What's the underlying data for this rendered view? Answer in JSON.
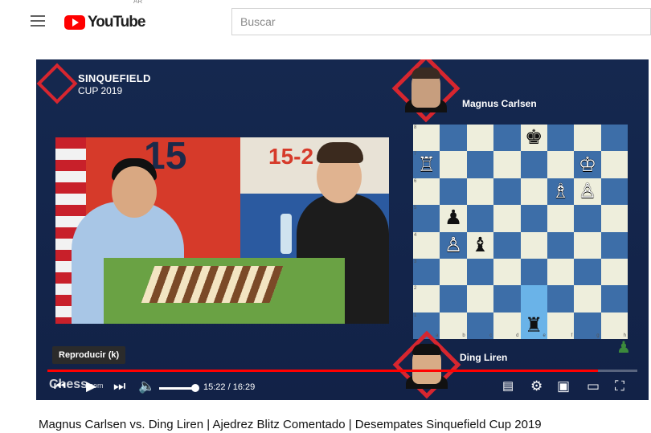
{
  "header": {
    "brand": "YouTube",
    "country": "AR",
    "search_placeholder": "Buscar"
  },
  "video": {
    "event_title": "SINQUEFIELD",
    "event_subtitle": "CUP 2019",
    "player_top": "Magnus Carlsen",
    "player_bottom": "Ding Liren",
    "tooltip": "Reproducir (k)",
    "watermark": "Chess",
    "watermark_suffix": "com",
    "scene_big_number": "15",
    "scene_score": "15-2",
    "time_display": "15:22 / 16:29",
    "progress_fraction": 0.933,
    "volume_fraction": 1.0
  },
  "chessboard": {
    "ranks": [
      "8",
      "7",
      "6",
      "5",
      "4",
      "3",
      "2",
      "1"
    ],
    "files": [
      "a",
      "b",
      "c",
      "d",
      "e",
      "f",
      "g",
      "h"
    ],
    "highlight": [
      "e2",
      "e1"
    ],
    "pieces": {
      "e8": "♚",
      "a7": "♖",
      "g7": "♔",
      "f6": "♗",
      "g6": "♙",
      "b5": "♟",
      "b4": "♙",
      "c4": "♝",
      "e1": "♜"
    }
  },
  "title": "Magnus Carlsen vs. Ding Liren | Ajedrez Blitz Comentado | Desempates Sinquefield Cup 2019",
  "colors": {
    "brand_red": "#ff0000",
    "event_red": "#d7262f",
    "player_bg": "#13254a",
    "board_dark": "#3d6ea8",
    "board_light": "#eeeedc"
  }
}
